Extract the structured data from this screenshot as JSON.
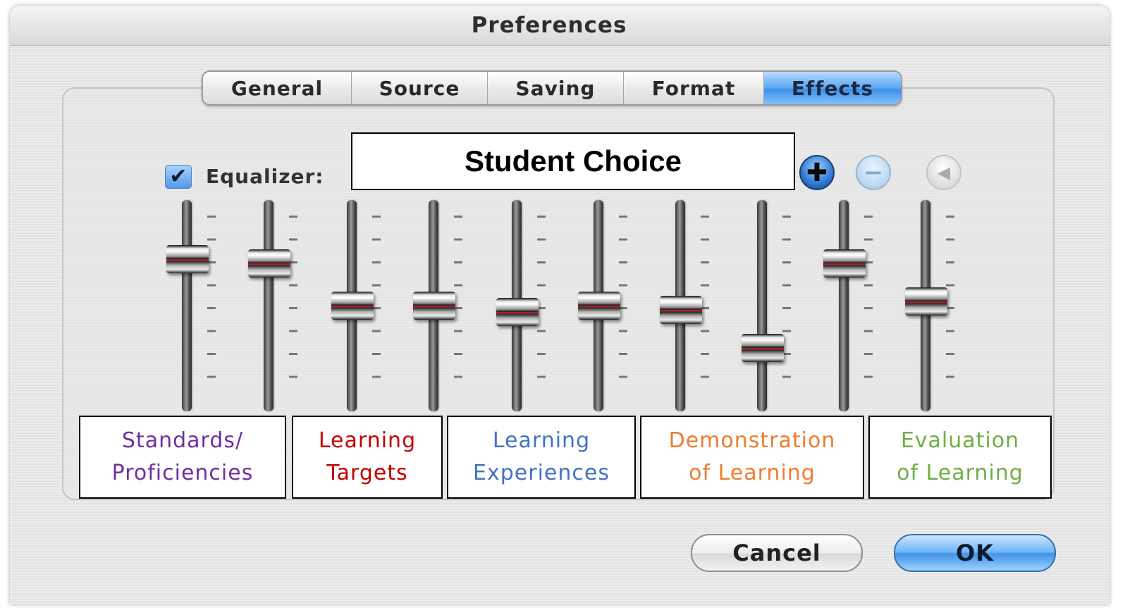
{
  "window": {
    "title": "Preferences"
  },
  "tabs": [
    {
      "label": "General",
      "active": false
    },
    {
      "label": "Source",
      "active": false
    },
    {
      "label": "Saving",
      "active": false
    },
    {
      "label": "Format",
      "active": false
    },
    {
      "label": "Effects",
      "active": true
    }
  ],
  "equalizer": {
    "checked": true,
    "check_glyph": "✔",
    "label": "Equalizer:",
    "preset_value": "Student Choice",
    "add_glyph": "✚",
    "remove_glyph": "−",
    "speaker_glyph": "◀",
    "icons": [
      "add-preset-icon",
      "remove-preset-icon",
      "speaker-icon"
    ],
    "band_levels": [
      0.72,
      0.7,
      0.5,
      0.5,
      0.47,
      0.5,
      0.48,
      0.3,
      0.7,
      0.52
    ]
  },
  "categories": [
    {
      "line1": "Standards/",
      "line2": "Proficiencies",
      "color": "#7030a0"
    },
    {
      "line1": "Learning",
      "line2": "Targets",
      "color": "#c00000"
    },
    {
      "line1": "Learning",
      "line2": "Experiences",
      "color": "#4472c4"
    },
    {
      "line1": "Demonstration",
      "line2": "of Learning",
      "color": "#ed7d31"
    },
    {
      "line1": "Evaluation",
      "line2": "of Learning",
      "color": "#70ad47"
    }
  ],
  "buttons": {
    "cancel": "Cancel",
    "ok": "OK"
  },
  "colors": {
    "accent_blue": "#3d8fe6"
  }
}
